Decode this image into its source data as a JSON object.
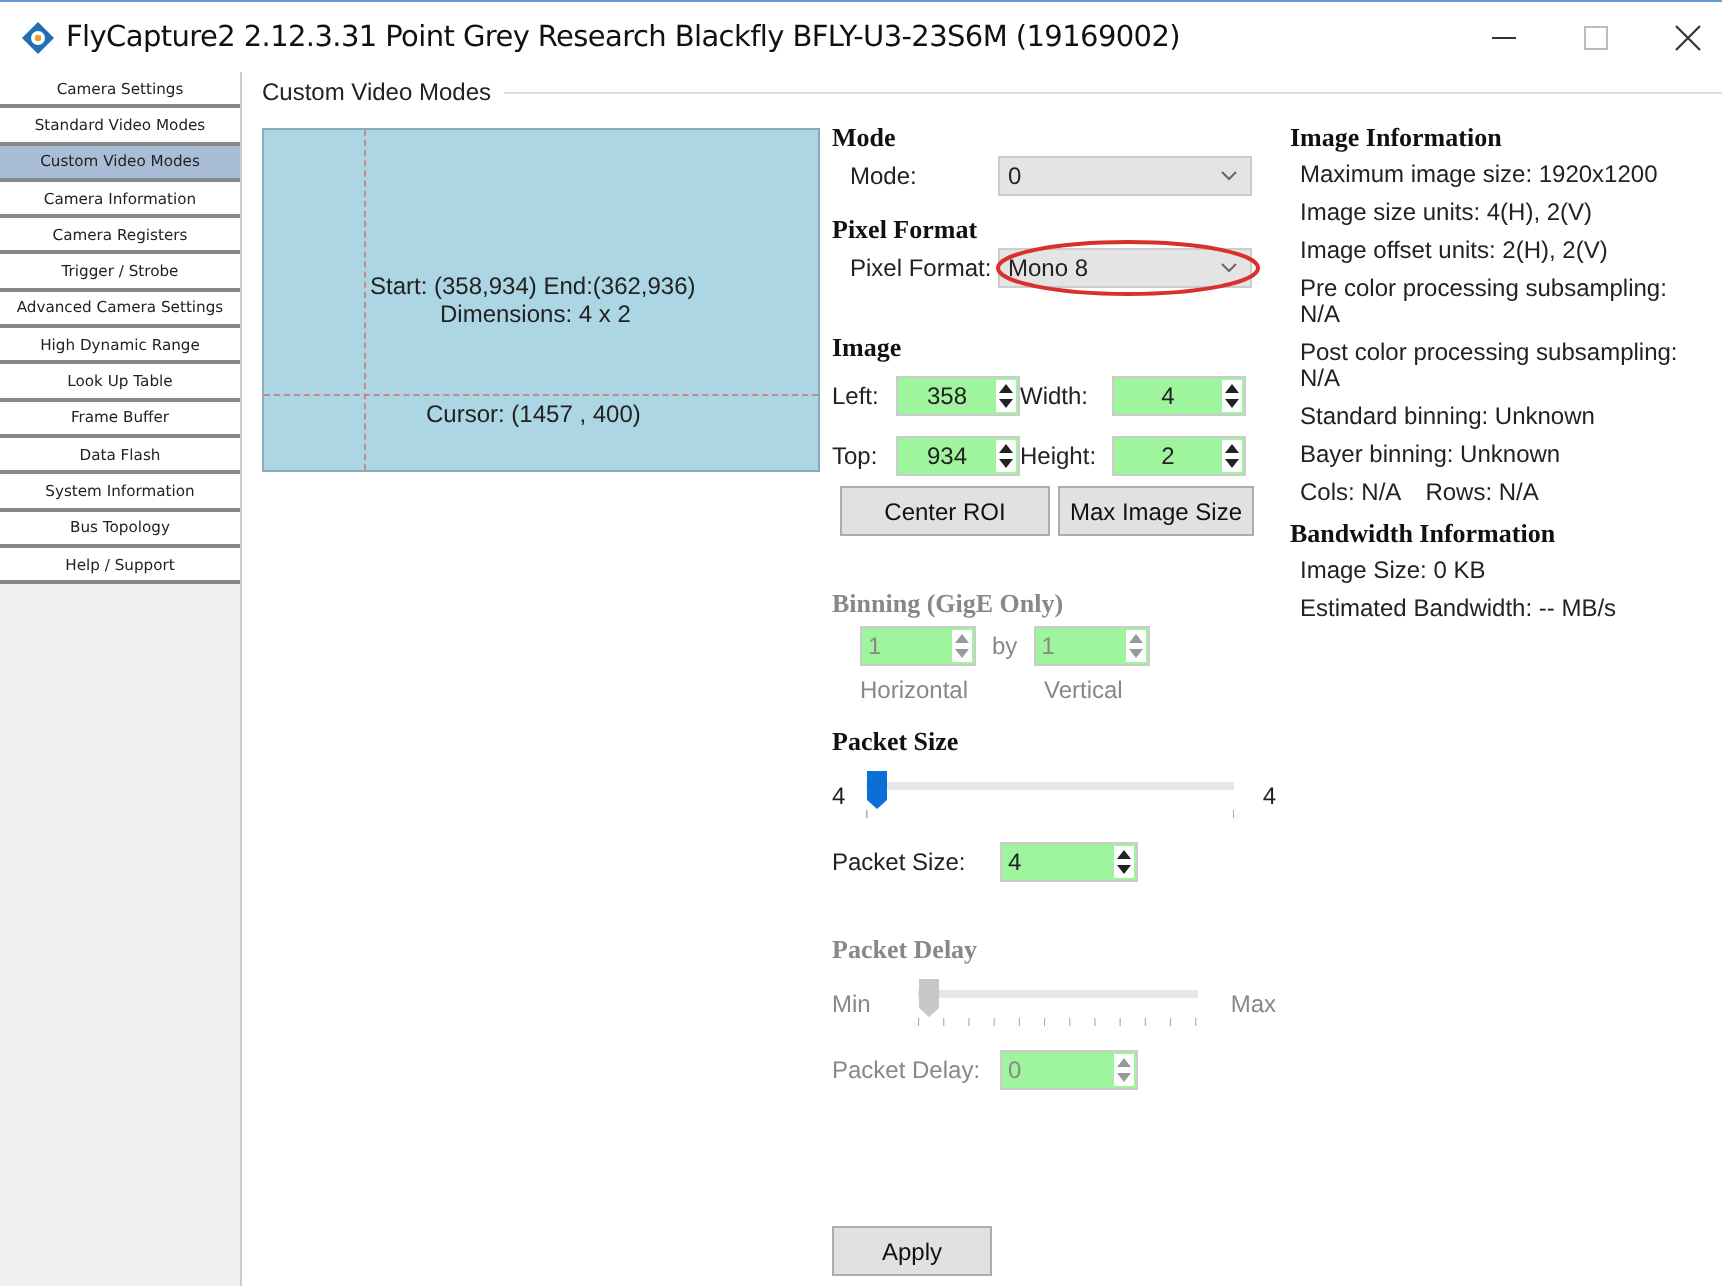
{
  "window": {
    "title": "FlyCapture2 2.12.3.31  Point Grey Research Blackfly BFLY-U3-23S6M (19169002)"
  },
  "sidebar": {
    "items": [
      {
        "label": "Camera Settings",
        "selected": false
      },
      {
        "label": "Standard Video Modes",
        "selected": false
      },
      {
        "label": "Custom Video Modes",
        "selected": true
      },
      {
        "label": "Camera Information",
        "selected": false
      },
      {
        "label": "Camera Registers",
        "selected": false
      },
      {
        "label": "Trigger / Strobe",
        "selected": false
      },
      {
        "label": "Advanced Camera Settings",
        "selected": false
      },
      {
        "label": "High Dynamic Range",
        "selected": false
      },
      {
        "label": "Look Up Table",
        "selected": false
      },
      {
        "label": "Frame Buffer",
        "selected": false
      },
      {
        "label": "Data Flash",
        "selected": false
      },
      {
        "label": "System Information",
        "selected": false
      },
      {
        "label": "Bus Topology",
        "selected": false
      },
      {
        "label": "Help / Support",
        "selected": false
      }
    ]
  },
  "group_title": "Custom Video Modes",
  "preview": {
    "start_end": "Start: (358,934) End:(362,936)",
    "dimensions": "Dimensions: 4 x 2",
    "cursor": "Cursor: (1457 , 400)"
  },
  "mode": {
    "heading": "Mode",
    "label": "Mode:",
    "value": "0"
  },
  "pixel_format": {
    "heading": "Pixel Format",
    "label": "Pixel Format:",
    "value": "Mono 8",
    "highlighted": true
  },
  "image": {
    "heading": "Image",
    "fields": [
      {
        "label": "Left:",
        "value": "358"
      },
      {
        "label": "Width:",
        "value": "4"
      },
      {
        "label": "Top:",
        "value": "934"
      },
      {
        "label": "Height:",
        "value": "2"
      }
    ],
    "buttons": [
      "Center ROI",
      "Max Image Size"
    ]
  },
  "binning": {
    "heading": "Binning (GigE Only)",
    "disabled": true,
    "horizontal": "1",
    "by": "by",
    "vertical": "1",
    "horizontal_label": "Horizontal",
    "vertical_label": "Vertical"
  },
  "packet_size": {
    "heading": "Packet Size",
    "disabled": false,
    "min": "4",
    "max": "4",
    "level": 0,
    "label": "Packet Size:",
    "value": "4"
  },
  "packet_delay": {
    "heading": "Packet Delay",
    "disabled": true,
    "min": "Min",
    "max": "Max",
    "level": 0,
    "label": "Packet Delay:",
    "value": "0"
  },
  "apply_button": "Apply",
  "image_information": {
    "heading": "Image Information",
    "lines": [
      [
        "Maximum image size: 1920x1200"
      ],
      [
        "Image size units: 4(H), 2(V)"
      ],
      [
        "Image offset units: 2(H), 2(V)"
      ],
      [
        "Pre color processing subsampling: N/A"
      ],
      [
        "Post color processing subsampling: N/A"
      ],
      [
        "Standard binning: Unknown"
      ],
      [
        "Bayer binning: Unknown"
      ],
      [
        "Cols: N/A",
        "Rows: N/A"
      ]
    ]
  },
  "bandwidth_information": {
    "heading": "Bandwidth Information",
    "lines": [
      [
        "Image Size: 0 KB"
      ],
      [
        "Estimated Bandwidth: -- MB/s"
      ]
    ]
  }
}
